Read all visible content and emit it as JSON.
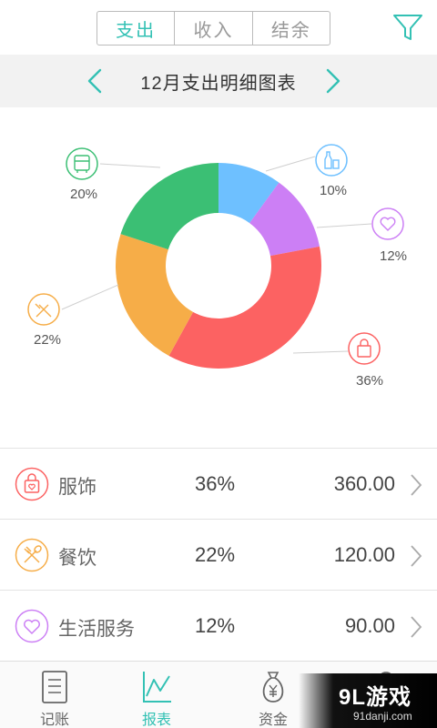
{
  "tabs": [
    {
      "label": "支出",
      "active": true
    },
    {
      "label": "收入",
      "active": false
    },
    {
      "label": "结余",
      "active": false
    }
  ],
  "filter_icon": "filter-icon",
  "month_title": "12月支出明细图表",
  "colors": {
    "accent": "#33c1b4",
    "blue": "#6ec0ff",
    "purple": "#cc7ff5",
    "red": "#fc6262",
    "orange": "#f6ad48",
    "green": "#3bbf74"
  },
  "chart_data": {
    "type": "pie",
    "donut": true,
    "slices": [
      {
        "label": "10%",
        "value": 10,
        "color": "#6ec0ff",
        "icon": "drink-icon"
      },
      {
        "label": "12%",
        "value": 12,
        "color": "#cc7ff5",
        "icon": "heart-icon"
      },
      {
        "label": "36%",
        "value": 36,
        "color": "#fc6262",
        "icon": "shopping-bag-icon"
      },
      {
        "label": "22%",
        "value": 22,
        "color": "#f6ad48",
        "icon": "utensils-icon"
      },
      {
        "label": "20%",
        "value": 20,
        "color": "#3bbf74",
        "icon": "bus-icon"
      }
    ]
  },
  "list": [
    {
      "name": "服饰",
      "pct": "36%",
      "amount": "360.00",
      "color": "#fc6262",
      "icon": "shopping-bag-icon"
    },
    {
      "name": "餐饮",
      "pct": "22%",
      "amount": "120.00",
      "color": "#f6ad48",
      "icon": "utensils-icon"
    },
    {
      "name": "生活服务",
      "pct": "12%",
      "amount": "90.00",
      "color": "#cc7ff5",
      "icon": "heart-icon"
    }
  ],
  "nav": [
    {
      "label": "记账",
      "icon": "notebook-icon",
      "active": false
    },
    {
      "label": "报表",
      "icon": "chart-icon",
      "active": true
    },
    {
      "label": "资金",
      "icon": "money-bag-icon",
      "active": false
    },
    {
      "label": "",
      "icon": "user-icon",
      "active": false
    }
  ],
  "watermark": {
    "big": "9L游戏",
    "small": "91danji.com"
  }
}
